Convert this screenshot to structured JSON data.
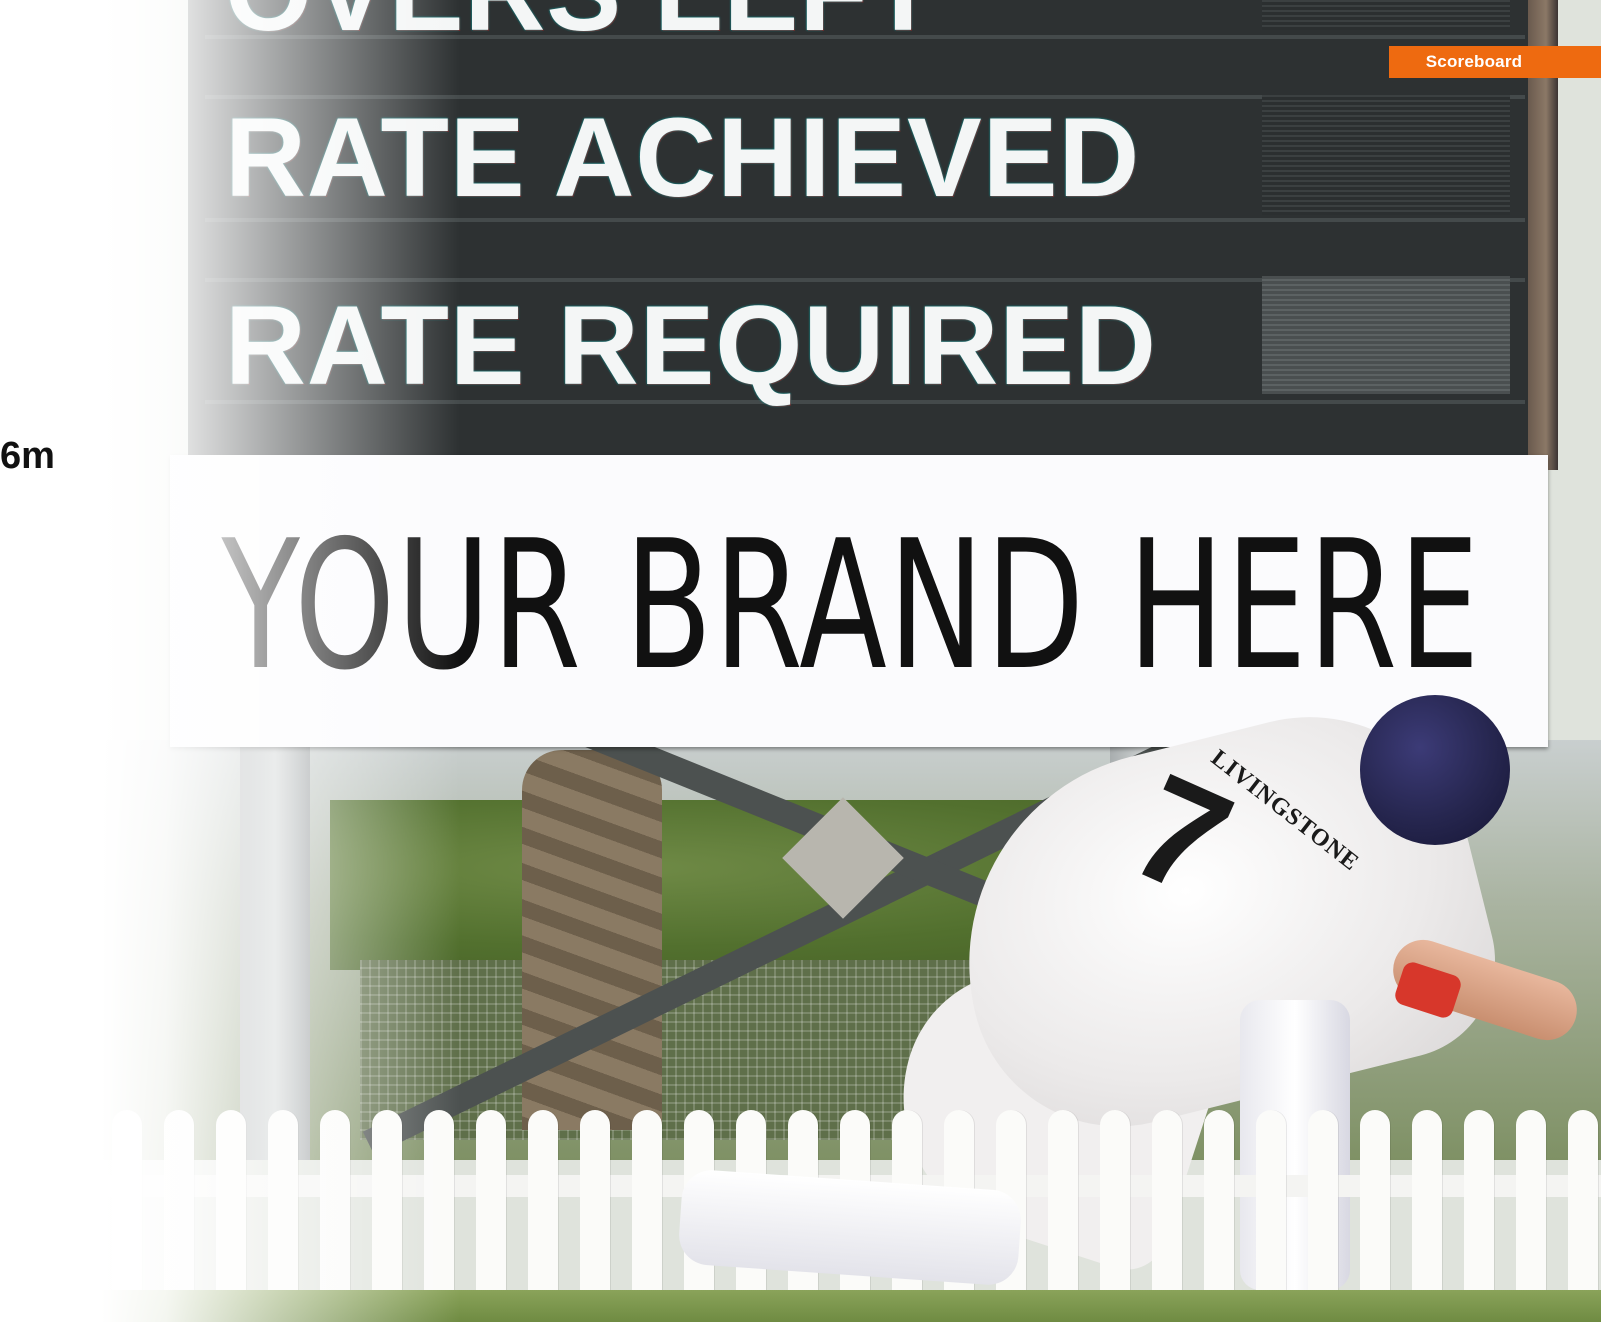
{
  "scoreboard": {
    "labels": [
      "OVERS LEFT",
      "RATE ACHIEVED",
      "RATE REQUIRED"
    ]
  },
  "banner": {
    "text": "YOUR BRAND HERE"
  },
  "player": {
    "name": "LIVINGSTONE",
    "number": "7"
  },
  "overlay": {
    "tag_label": "Scoreboard",
    "side_value": "6m",
    "accent_color": "#ee6a10"
  }
}
